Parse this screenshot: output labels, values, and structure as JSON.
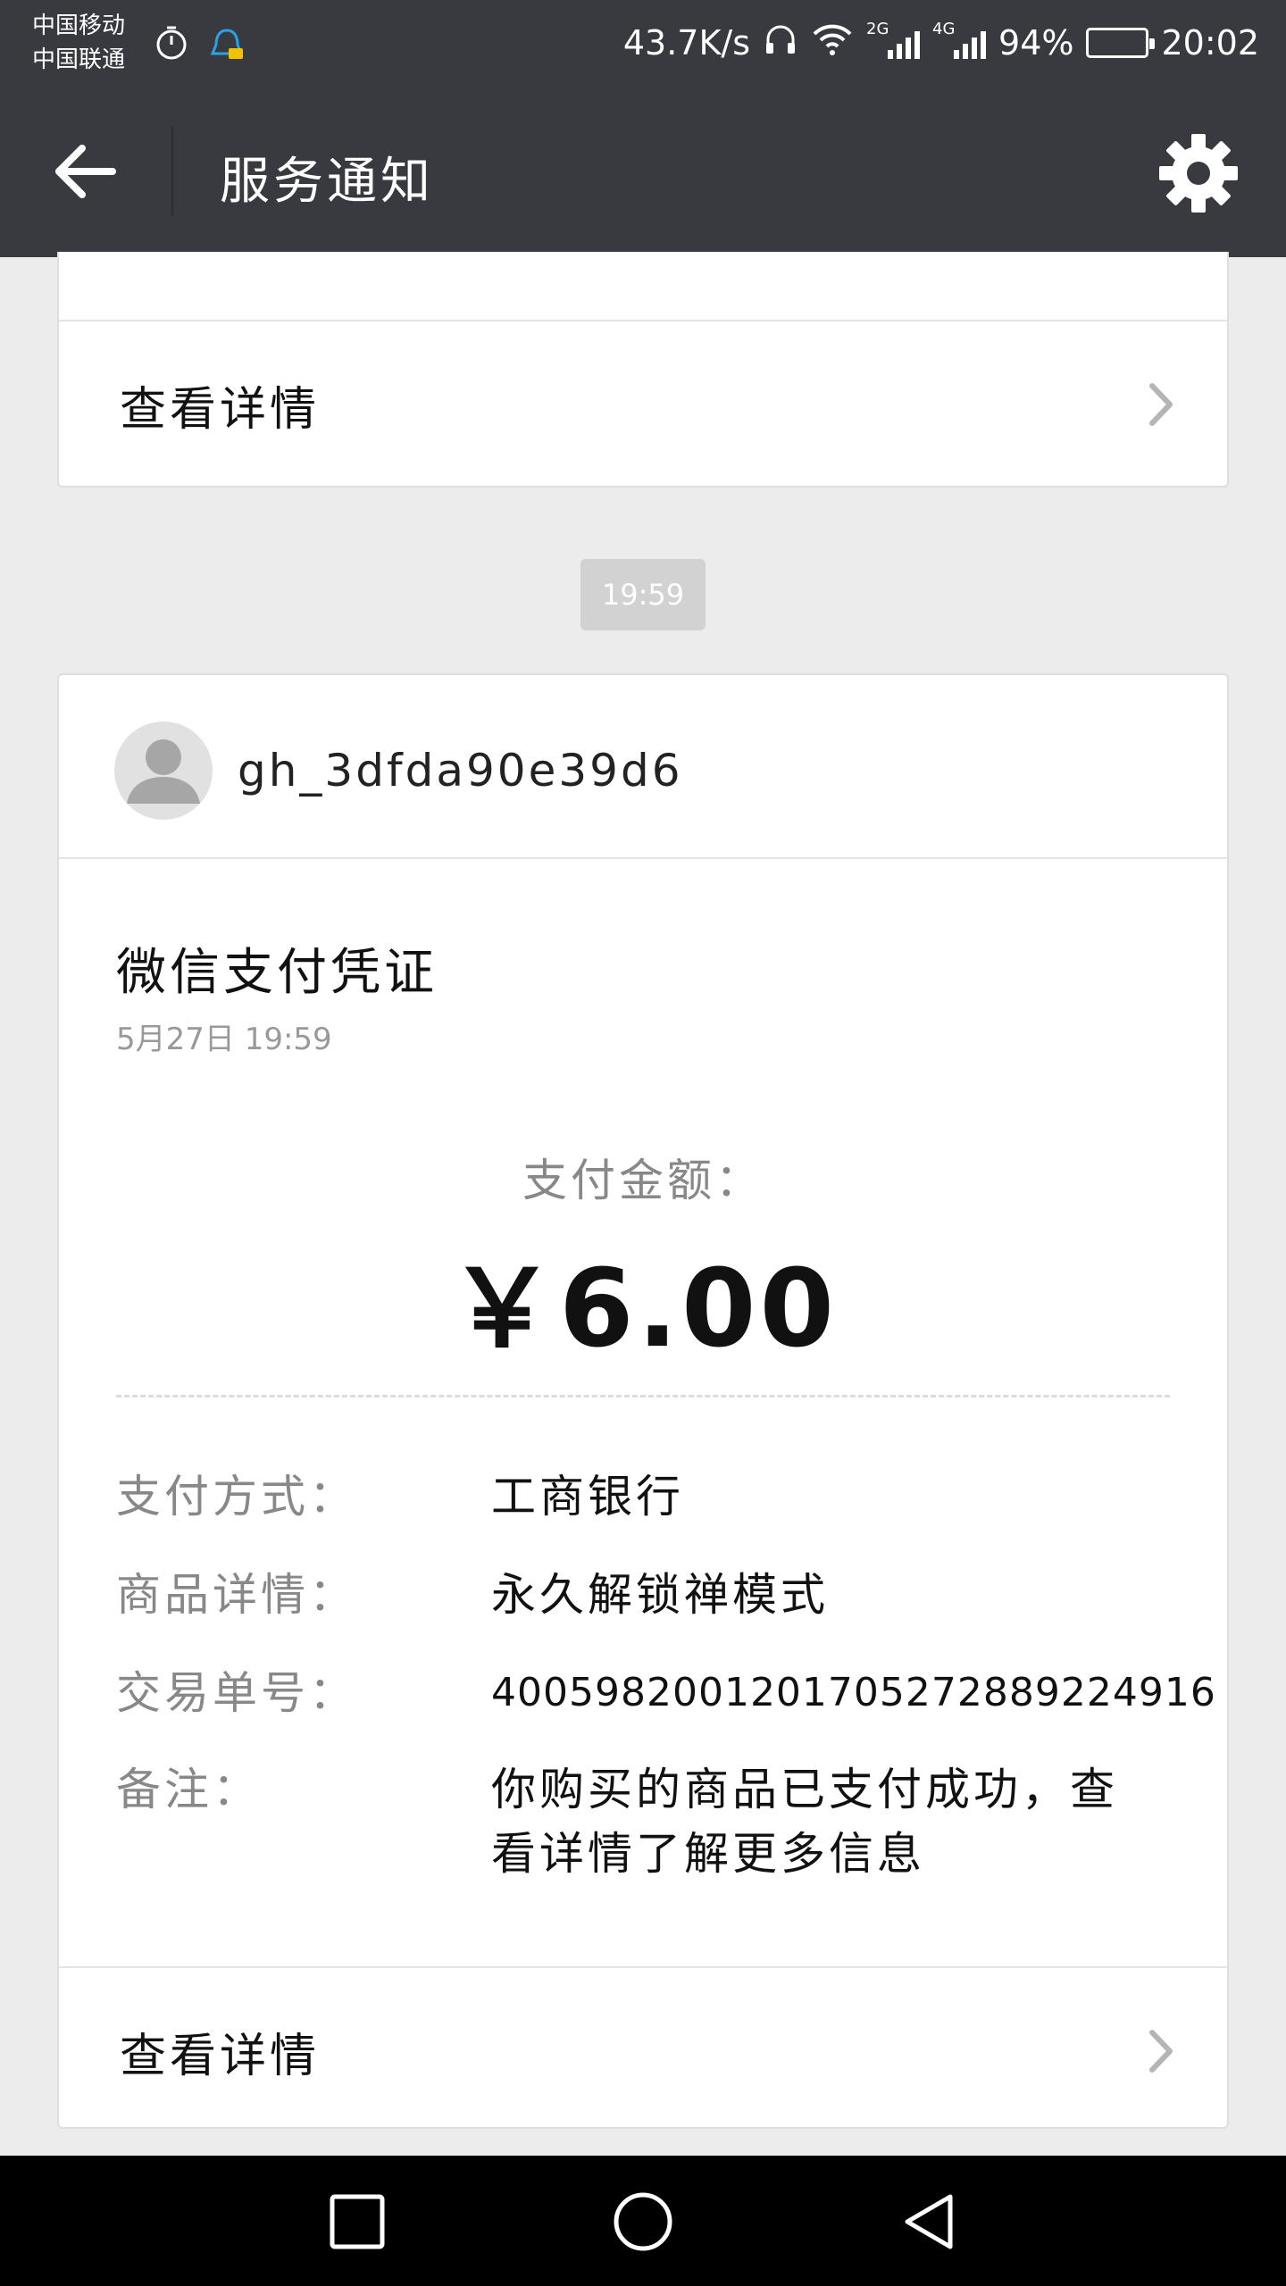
{
  "status_bar": {
    "carrier_1": "中国移动",
    "carrier_2": "中国联通",
    "net_speed": "43.7K/s",
    "gen_2": "2G",
    "gen_4": "4G",
    "battery_pct": "94%",
    "battery_level": 0.94,
    "time": "20:02"
  },
  "header": {
    "title": "服务通知"
  },
  "previous_card": {
    "detail_label": "查看详情"
  },
  "time_divider": "19:59",
  "notification": {
    "account_name": "gh_3dfda90e39d6",
    "title": "微信支付凭证",
    "date": "5月27日  19:59",
    "amount_label": "支付金额：",
    "amount_value": "￥6.00",
    "fields": [
      {
        "key": "支付方式：",
        "value": "工商银行"
      },
      {
        "key": "商品详情：",
        "value": "永久解锁禅模式"
      },
      {
        "key": "交易单号：",
        "value": "4005982001201705272889224916"
      },
      {
        "key": "备注：",
        "value": "你购买的商品已支付成功，查看详情了解更多信息"
      }
    ],
    "detail_label": "查看详情"
  },
  "colors": {
    "header_bg": "#393a3f",
    "page_bg": "#ececec",
    "card_bg": "#ffffff"
  }
}
